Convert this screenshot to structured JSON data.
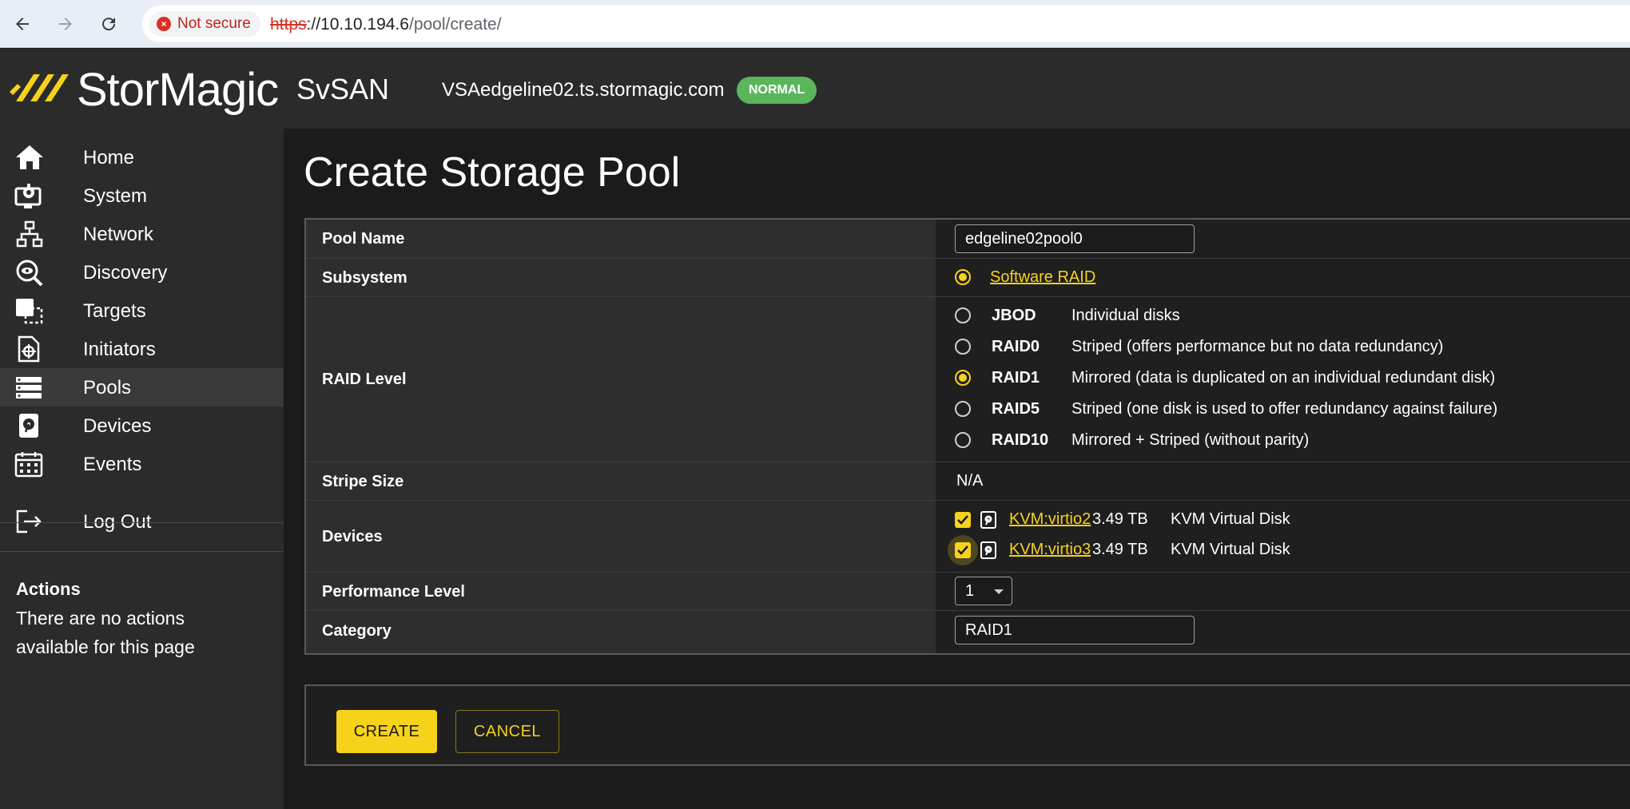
{
  "browser": {
    "security_label": "Not secure",
    "url_scheme": "https",
    "url_host": "://10.10.194.6",
    "url_path": "/pool/create/"
  },
  "header": {
    "logo_text": "StorMagic",
    "product": "SvSAN",
    "hostname": "VSAedgeline02.ts.stormagic.com",
    "status": "NORMAL",
    "status_color": "#5bb55b",
    "accent_color": "#f6d21b"
  },
  "sidebar": {
    "items": [
      {
        "label": "Home",
        "icon": "home-icon"
      },
      {
        "label": "System",
        "icon": "system-icon"
      },
      {
        "label": "Network",
        "icon": "network-icon"
      },
      {
        "label": "Discovery",
        "icon": "discovery-icon"
      },
      {
        "label": "Targets",
        "icon": "targets-icon"
      },
      {
        "label": "Initiators",
        "icon": "initiators-icon"
      },
      {
        "label": "Pools",
        "icon": "pools-icon",
        "active": true
      },
      {
        "label": "Devices",
        "icon": "devices-icon"
      },
      {
        "label": "Events",
        "icon": "events-icon"
      },
      {
        "label": "Log Out",
        "icon": "logout-icon"
      }
    ],
    "actions_title": "Actions",
    "actions_text": "There are no actions available for this page"
  },
  "main": {
    "title": "Create Storage Pool",
    "form": {
      "pool_name_label": "Pool Name",
      "pool_name_value": "edgeline02pool0",
      "subsystem_label": "Subsystem",
      "subsystem_value": "Software RAID",
      "raid_level_label": "RAID Level",
      "raid_levels": [
        {
          "name": "JBOD",
          "desc": "Individual disks",
          "selected": false
        },
        {
          "name": "RAID0",
          "desc": "Striped (offers performance but no data redundancy)",
          "selected": false
        },
        {
          "name": "RAID1",
          "desc": "Mirrored (data is duplicated on an individual redundant disk)",
          "selected": true
        },
        {
          "name": "RAID5",
          "desc": "Striped (one disk is used to offer redundancy against failure)",
          "selected": false
        },
        {
          "name": "RAID10",
          "desc": "Mirrored + Striped (without parity)",
          "selected": false
        }
      ],
      "stripe_size_label": "Stripe Size",
      "stripe_size_value": "N/A",
      "devices_label": "Devices",
      "devices": [
        {
          "name": "KVM:virtio2",
          "size": "3.49 TB",
          "type": "KVM Virtual Disk",
          "checked": true
        },
        {
          "name": "KVM:virtio3",
          "size": "3.49 TB",
          "type": "KVM Virtual Disk",
          "checked": true
        }
      ],
      "performance_label": "Performance Level",
      "performance_value": "1",
      "category_label": "Category",
      "category_value": "RAID1"
    },
    "buttons": {
      "create": "CREATE",
      "cancel": "CANCEL"
    }
  }
}
